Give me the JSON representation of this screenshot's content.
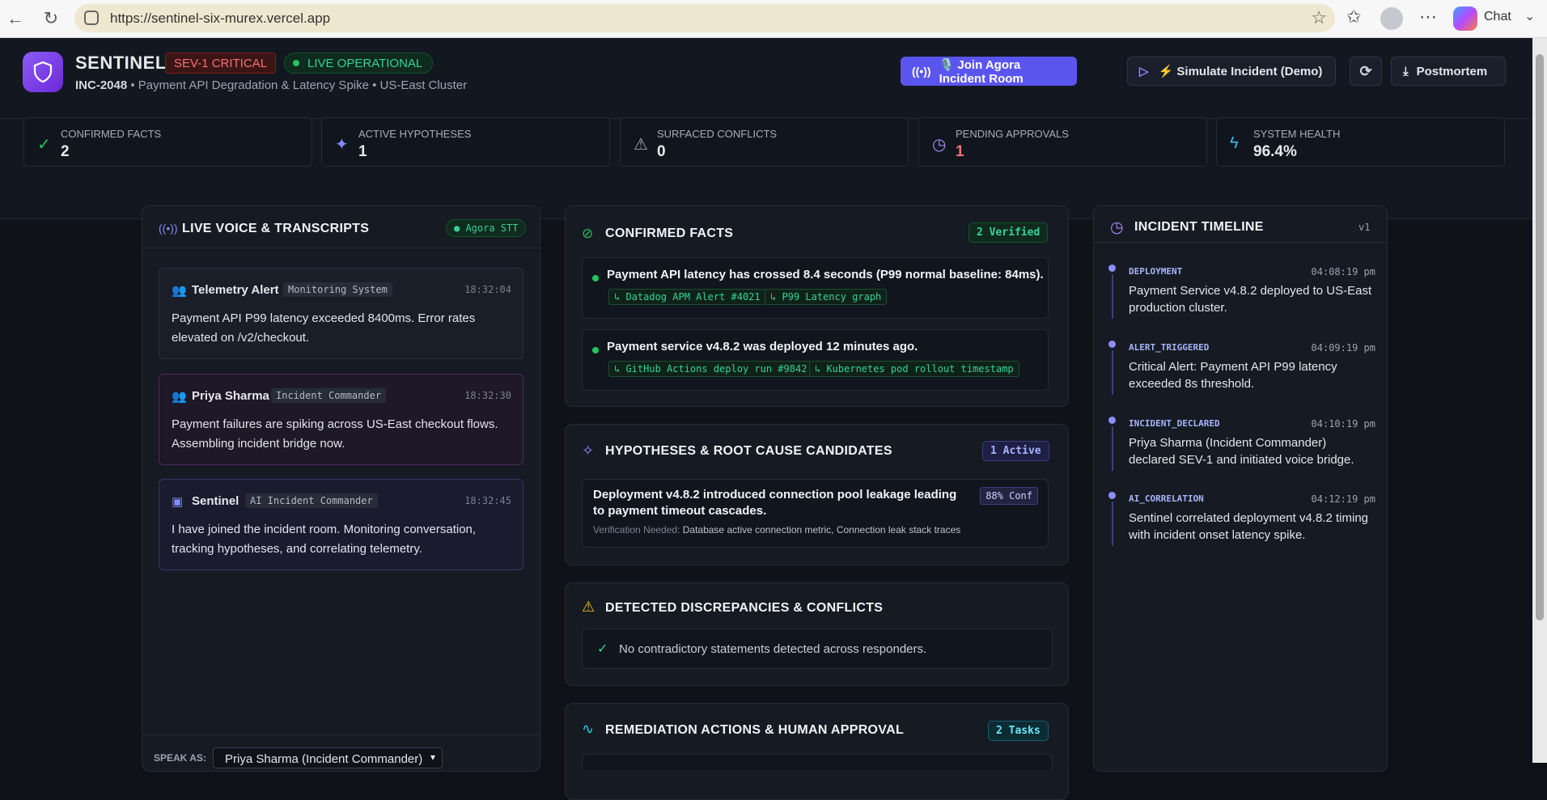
{
  "browser": {
    "url": "https://sentinel-six-murex.vercel.app",
    "chat_label": "Chat"
  },
  "header": {
    "brand": "SENTINEL",
    "severity_badge": "SEV-1 CRITICAL",
    "status_badge": "LIVE OPERATIONAL",
    "incident_id": "INC-2048",
    "incident_desc": " • Payment API Degradation & Latency Spike • US-East Cluster",
    "join_button": "🎙️ Join Agora Incident Room",
    "simulate_button": "⚡ Simulate Incident (Demo)",
    "postmortem_button": "Postmortem"
  },
  "stats": [
    {
      "label": "CONFIRMED FACTS",
      "value": "2",
      "icon": "check-circle-icon",
      "color": "#22c55e"
    },
    {
      "label": "ACTIVE HYPOTHESES",
      "value": "1",
      "icon": "sparkles-icon",
      "color": "#818cf8"
    },
    {
      "label": "SURFACED CONFLICTS",
      "value": "0",
      "icon": "alert-triangle-icon",
      "color": "#9ca3af"
    },
    {
      "label": "PENDING APPROVALS",
      "value": "1",
      "icon": "clock-icon",
      "color": "#f87171"
    },
    {
      "label": "SYSTEM HEALTH",
      "value": "96.4%",
      "icon": "lightning-icon",
      "color": "#38bdf8"
    }
  ],
  "voice": {
    "title": "LIVE VOICE & TRANSCRIPTS",
    "stt_badge": "Agora STT",
    "messages": [
      {
        "name": "Telemetry Alert",
        "role": "Monitoring System",
        "time": "18:32:04",
        "text": "Payment API P99 latency exceeded 8400ms. Error rates elevated on /v2/checkout."
      },
      {
        "name": "Priya Sharma",
        "role": "Incident Commander",
        "time": "18:32:30",
        "text": "Payment failures are spiking across US-East checkout flows. Assembling incident bridge now."
      },
      {
        "name": "Sentinel",
        "role": "AI Incident Commander",
        "time": "18:32:45",
        "text": "I have joined the incident room. Monitoring conversation, tracking hypotheses, and correlating telemetry."
      }
    ],
    "speak_as_label": "SPEAK AS:",
    "speak_as_value": "Priya Sharma (Incident Commander)"
  },
  "facts": {
    "title": "CONFIRMED FACTS",
    "badge": "2 Verified",
    "items": [
      {
        "text": "Payment API latency has crossed 8.4 seconds (P99 normal baseline: 84ms).",
        "evidence": [
          "↳ Datadog APM Alert #4021",
          "↳ P99 Latency graph"
        ]
      },
      {
        "text": "Payment service v4.8.2 was deployed 12 minutes ago.",
        "evidence": [
          "↳ GitHub Actions deploy run #9842",
          "↳ Kubernetes pod rollout timestamp"
        ]
      }
    ]
  },
  "hypotheses": {
    "title": "HYPOTHESES & ROOT CAUSE CANDIDATES",
    "badge": "1 Active",
    "item": {
      "text": "Deployment v4.8.2 introduced connection pool leakage leading to payment timeout cascades.",
      "confidence": "88% Conf",
      "verification_label": "Verification Needed:",
      "verification_text": " Database active connection metric, Connection leak stack traces"
    }
  },
  "conflicts": {
    "title": "DETECTED DISCREPANCIES & CONFLICTS",
    "empty_text": "No contradictory statements detected across responders."
  },
  "remediation": {
    "title": "REMEDIATION ACTIONS & HUMAN APPROVAL",
    "badge": "2 Tasks"
  },
  "timeline": {
    "title": "INCIDENT TIMELINE",
    "version": "v1",
    "events": [
      {
        "type": "DEPLOYMENT",
        "time": "04:08:19 pm",
        "text": "Payment Service v4.8.2 deployed to US-East production cluster."
      },
      {
        "type": "ALERT_TRIGGERED",
        "time": "04:09:19 pm",
        "text": "Critical Alert: Payment API P99 latency exceeded 8s threshold."
      },
      {
        "type": "INCIDENT_DECLARED",
        "time": "04:10:19 pm",
        "text": "Priya Sharma (Incident Commander) declared SEV-1 and initiated voice bridge."
      },
      {
        "type": "AI_CORRELATION",
        "time": "04:12:19 pm",
        "text": "Sentinel correlated deployment v4.8.2 timing with incident onset latency spike."
      }
    ]
  }
}
